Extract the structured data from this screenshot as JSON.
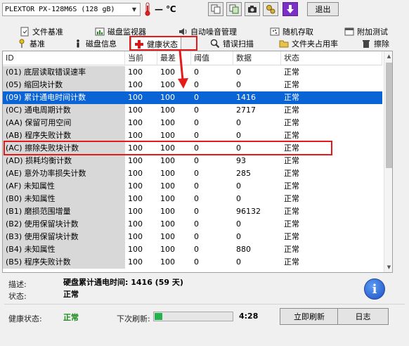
{
  "toolbar": {
    "drive": "PLEXTOR PX-128M6S (128 gB)",
    "temperature": "— ℃",
    "exit_label": "退出",
    "colors": {
      "thermometer": "#e02020",
      "download_btn": "#7b2fc6"
    }
  },
  "tabs": {
    "row1": [
      {
        "label": "文件基准",
        "icon": "file-benchmark-icon"
      },
      {
        "label": "磁盘监视器",
        "icon": "disk-monitor-icon"
      },
      {
        "label": "自动噪音管理",
        "icon": "speaker-icon"
      },
      {
        "label": "随机存取",
        "icon": "random-access-icon"
      },
      {
        "label": "附加测试",
        "icon": "extra-tests-icon"
      }
    ],
    "row2": [
      {
        "label": "基准",
        "icon": "benchmark-icon"
      },
      {
        "label": "磁盘信息",
        "icon": "disk-info-icon"
      },
      {
        "label": "健康状态",
        "icon": "health-cross-icon",
        "active": true
      },
      {
        "label": "错误扫描",
        "icon": "magnifier-icon"
      },
      {
        "label": "文件夹占用率",
        "icon": "folder-icon"
      },
      {
        "label": "擦除",
        "icon": "trash-icon"
      }
    ]
  },
  "table": {
    "columns": [
      "ID",
      "当前",
      "最差",
      "阈值",
      "数据",
      "状态"
    ],
    "rows": [
      [
        "(01) 底层读取错误速率",
        "100",
        "100",
        "0",
        "0",
        "正常"
      ],
      [
        "(05) 缩回块计数",
        "100",
        "100",
        "0",
        "0",
        "正常"
      ],
      [
        "(09) 累计通电时间计数",
        "100",
        "100",
        "0",
        "1416",
        "正常"
      ],
      [
        "(0C) 通电周期计数",
        "100",
        "100",
        "0",
        "2717",
        "正常"
      ],
      [
        "(AA) 保留可用空间",
        "100",
        "100",
        "0",
        "0",
        "正常"
      ],
      [
        "(AB) 程序失败计数",
        "100",
        "100",
        "0",
        "0",
        "正常"
      ],
      [
        "(AC) 擦除失败块计数",
        "100",
        "100",
        "0",
        "0",
        "正常"
      ],
      [
        "(AD) 损耗均衡计数",
        "100",
        "100",
        "0",
        "93",
        "正常"
      ],
      [
        "(AE) 意外功率损失计数",
        "100",
        "100",
        "0",
        "285",
        "正常"
      ],
      [
        "(AF) 未知属性",
        "100",
        "100",
        "0",
        "0",
        "正常"
      ],
      [
        "(B0) 未知属性",
        "100",
        "100",
        "0",
        "0",
        "正常"
      ],
      [
        "(B1) 磨损范围增量",
        "100",
        "100",
        "0",
        "96132",
        "正常"
      ],
      [
        "(B2) 使用保留块计数",
        "100",
        "100",
        "0",
        "0",
        "正常"
      ],
      [
        "(B3) 使用保留块计数",
        "100",
        "100",
        "0",
        "0",
        "正常"
      ],
      [
        "(B4) 未知属性",
        "100",
        "100",
        "0",
        "880",
        "正常"
      ],
      [
        "(B5) 程序失败计数",
        "100",
        "100",
        "0",
        "0",
        "正常"
      ]
    ],
    "selected_row": 2,
    "colors": {
      "selection": "#0a64d6",
      "highlight": "#e41b1b"
    }
  },
  "details": {
    "desc_label": "描述:",
    "desc_value": "硬盘累计通电时间: 1416 (59 天)",
    "status_label": "状态:",
    "status_value": "正常",
    "health_label": "健康状态:",
    "health_value": "正常",
    "refresh_label": "下次刷新:",
    "countdown": "4:28",
    "refresh_progress": 0.1,
    "refresh_btn": "立即刷新",
    "log_btn": "日志"
  }
}
